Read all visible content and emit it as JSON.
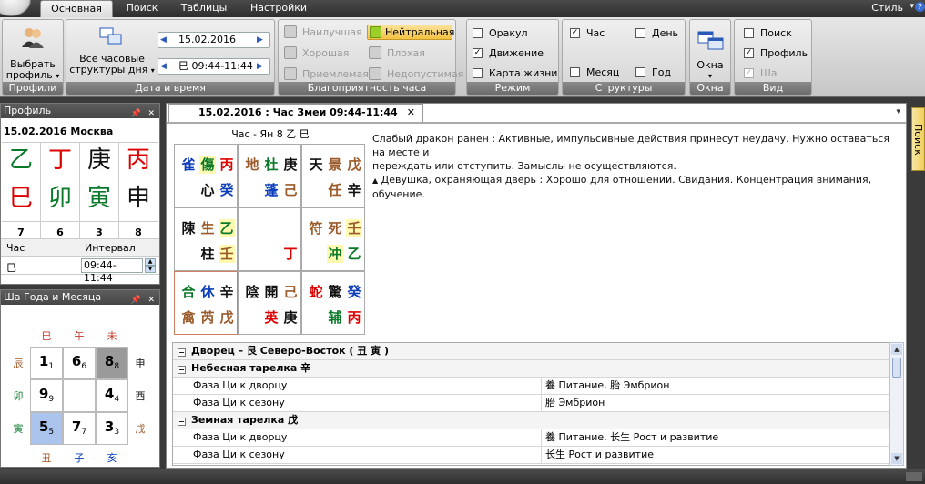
{
  "tabs": [
    "Основная",
    "Поиск",
    "Таблицы",
    "Настройки"
  ],
  "style_menu": "Стиль",
  "ribbon": {
    "profiles": {
      "button": [
        "Выбрать",
        "профиль"
      ],
      "title": "Профили"
    },
    "datetime": {
      "all_structures": [
        "Все часовые",
        "структуры дня"
      ],
      "date": "15.02.2016",
      "time_value": "巳 09:44-11:44",
      "title": "Дата и время"
    },
    "favorability": {
      "items": [
        "Наилучшая",
        "Хорошая",
        "Приемлемая",
        "Нейтральная",
        "Плохая",
        "Недопустимая"
      ],
      "active": "Нейтральная",
      "title": "Благоприятность часа"
    },
    "mode": {
      "items": [
        {
          "label": "Оракул",
          "checked": false
        },
        {
          "label": "Движение",
          "checked": true
        },
        {
          "label": "Карта жизни",
          "checked": false
        }
      ],
      "title": "Режим"
    },
    "structures": {
      "items": [
        {
          "label": "Час",
          "checked": true
        },
        {
          "label": "День",
          "checked": false
        },
        {
          "label": "Месяц",
          "checked": false
        },
        {
          "label": "Год",
          "checked": false
        }
      ],
      "title": "Структуры"
    },
    "windows": {
      "button": "Окна",
      "title": "Окна"
    },
    "view": {
      "items": [
        {
          "label": "Поиск",
          "checked": false,
          "disabled": false
        },
        {
          "label": "Профиль",
          "checked": true,
          "disabled": false
        },
        {
          "label": "Ша",
          "checked": true,
          "disabled": true
        }
      ],
      "title": "Вид"
    }
  },
  "profile_panel": {
    "title": "Профиль",
    "date_place": "15.02.2016 Москва",
    "stems": [
      "乙",
      "丁",
      "庚",
      "丙"
    ],
    "stem_colors": [
      "#0a7a2a",
      "#d00",
      "#111",
      "#d00"
    ],
    "branches": [
      "巳",
      "卯",
      "寅",
      "申"
    ],
    "branch_colors": [
      "#d00",
      "#0a7a2a",
      "#0a7a2a",
      "#111"
    ],
    "numbers": [
      "7",
      "6",
      "3",
      "8"
    ],
    "col_hour": "Час",
    "col_interval": "Интервал",
    "hour_value": "巳",
    "interval_value": "09:44-11:44"
  },
  "sha_panel": {
    "title": "Ша Года и Месяца",
    "top": [
      "巳",
      "午",
      "未"
    ],
    "left": [
      "辰",
      "卯",
      "寅"
    ],
    "right": [
      "申",
      "酉",
      "戌"
    ],
    "bottom": [
      "丑",
      "子",
      "亥"
    ],
    "grid": [
      [
        "1",
        "1"
      ],
      [
        "6",
        "6"
      ],
      [
        "8",
        "8"
      ],
      [
        "9",
        "9"
      ],
      [
        "",
        ""
      ],
      [
        "4",
        "4"
      ],
      [
        "5",
        "5"
      ],
      [
        "7",
        "7"
      ],
      [
        "3",
        "3"
      ]
    ]
  },
  "doc": {
    "tab_title": "15.02.2016 : Час Змеи 09:44-11:44",
    "chart_header": "Час - Ян 8 乙 巳",
    "palaces": [
      {
        "r1": [
          "雀",
          "傷",
          "丙"
        ],
        "r2": [
          "",
          "心",
          "癸"
        ]
      },
      {
        "r1": [
          "地",
          "杜",
          "庚"
        ],
        "r2": [
          "",
          "蓬",
          "己"
        ]
      },
      {
        "r1": [
          "天",
          "景",
          "戊"
        ],
        "r2": [
          "",
          "任",
          "辛"
        ]
      },
      {
        "r1": [
          "陳",
          "生",
          "乙"
        ],
        "r2": [
          "",
          "柱",
          "壬"
        ]
      },
      {
        "r1": [
          "",
          "",
          ""
        ],
        "r2": [
          "",
          "",
          "丁"
        ]
      },
      {
        "r1": [
          "符",
          "死",
          "壬"
        ],
        "r2": [
          "",
          "冲",
          "乙"
        ]
      },
      {
        "r1": [
          "合",
          "休",
          "辛"
        ],
        "r2": [
          "禽",
          "芮",
          "戊"
        ]
      },
      {
        "r1": [
          "陰",
          "開",
          "己"
        ],
        "r2": [
          "",
          "英",
          "庚"
        ]
      },
      {
        "r1": [
          "蛇",
          "驚",
          "癸"
        ],
        "r2": [
          "",
          "辅",
          "丙"
        ]
      }
    ],
    "desc_line1": "Слабый дракон ранен : Активные, импульсивные  действия принесут неудачу. Нужно оставаться на месте и",
    "desc_line2": "переждать или отступить. Замыслы не осуществляются.",
    "desc_line3": "Девушка, охраняющая дверь : Хорошо для отношений. Свидания. Концентрация внимания, обучение."
  },
  "property_grid": [
    {
      "type": "cat",
      "name": "Дворец – 艮 Северо-Восток ( 丑  寅 )"
    },
    {
      "type": "cat",
      "name": "Небесная тарелка   辛"
    },
    {
      "type": "row",
      "name": "Фаза Ци к дворцу",
      "value": "養 Питание, 胎 Эмбрион"
    },
    {
      "type": "row",
      "name": "Фаза Ци к сезону",
      "value": "胎 Эмбрион"
    },
    {
      "type": "cat",
      "name": "Земная тарелка   戊"
    },
    {
      "type": "row",
      "name": "Фаза Ци к дворцу",
      "value": "養 Питание, 长生 Рост и развитие"
    },
    {
      "type": "row",
      "name": "Фаза Ци к сезону",
      "value": "长生 Рост и развитие"
    }
  ],
  "side_tab": "Поиск"
}
